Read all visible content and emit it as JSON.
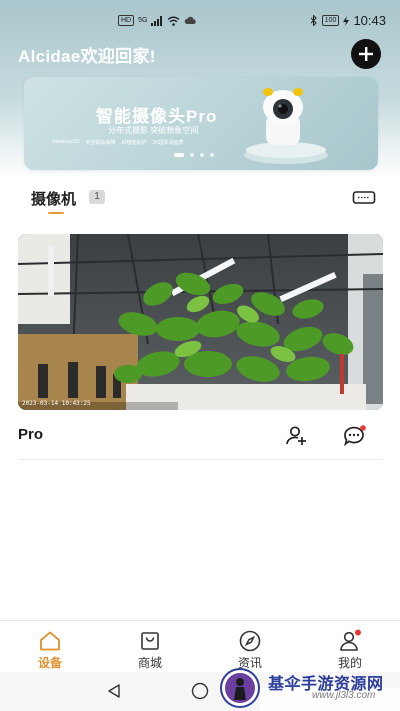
{
  "status_bar": {
    "hd": "HD",
    "signal": "5G",
    "battery": "100",
    "time": "10:43"
  },
  "header": {
    "greeting": "Alcidae欢迎回家!"
  },
  "banner": {
    "title": "智能摄像头Pro",
    "subtitle": "分布式摄影  突破想象空间",
    "tags": [
      "HarmonyOS",
      "安全隐私保障",
      "AI智能看护",
      "2K超高清画质"
    ]
  },
  "devices": {
    "title": "摄像机",
    "count": "1"
  },
  "camera": {
    "name": "Pro",
    "osd": "2023-03-14 10:43:25"
  },
  "tabs": [
    {
      "label": "设备",
      "icon": "home-icon",
      "active": true
    },
    {
      "label": "商城",
      "icon": "shopping-bag-icon",
      "active": false
    },
    {
      "label": "资讯",
      "icon": "compass-icon",
      "active": false
    },
    {
      "label": "我的",
      "icon": "profile-icon",
      "active": false
    }
  ],
  "watermark": {
    "text": "基伞手游资源网",
    "url": "www.jl3l3.com"
  },
  "colors": {
    "accent": "#e0922e",
    "header": "#a9c6cc",
    "badge_dot": "#e53935"
  }
}
